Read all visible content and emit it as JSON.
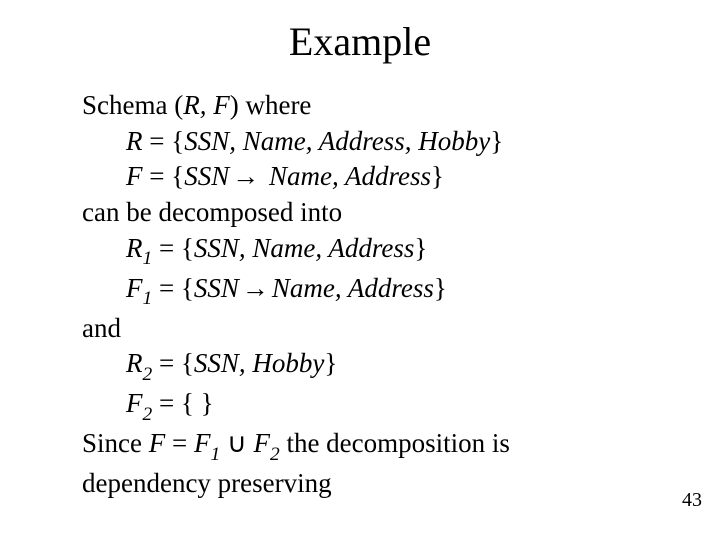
{
  "title": "Example",
  "lines": {
    "l1_before": "Schema (",
    "l1_var": "R, F",
    "l1_after": ") where",
    "l2_var": "R",
    "l2_eq": " = {",
    "l2_set": "SSN, Name, Address, Hobby",
    "l2_close": "}",
    "l3_var": "F",
    "l3_eq": " = {",
    "l3_lhs": "SSN",
    "l3_arrow": "→",
    "l3_rhs": " Name, Address",
    "l3_close": "}",
    "l4": "can be decomposed into",
    "l5_var": "R",
    "l5_sub": "1",
    "l5_rest": " = {",
    "l5_set": "SSN, Name, Address",
    "l5_close": "}",
    "l6_var": "F",
    "l6_sub": "1",
    "l6_eq": " = {",
    "l6_lhs": "SSN",
    "l6_arrow": "→",
    "l6_rhs": "Name, Address",
    "l6_close": "}",
    "l7": "and",
    "l8_var": "R",
    "l8_sub": "2",
    "l8_rest": " = {",
    "l8_set": "SSN, Hobby",
    "l8_close": "}",
    "l9_var": "F",
    "l9_sub": "2",
    "l9_rest": " = { }",
    "l10_a": "Since ",
    "l10_F": "F",
    "l10_b": " = ",
    "l10_F1v": "F",
    "l10_F1s": "1",
    "l10_cup": " ∪ ",
    "l10_F2v": "F",
    "l10_F2s": "2",
    "l10_c": " the decomposition is",
    "l11": "dependency preserving"
  },
  "pagenum": "43"
}
